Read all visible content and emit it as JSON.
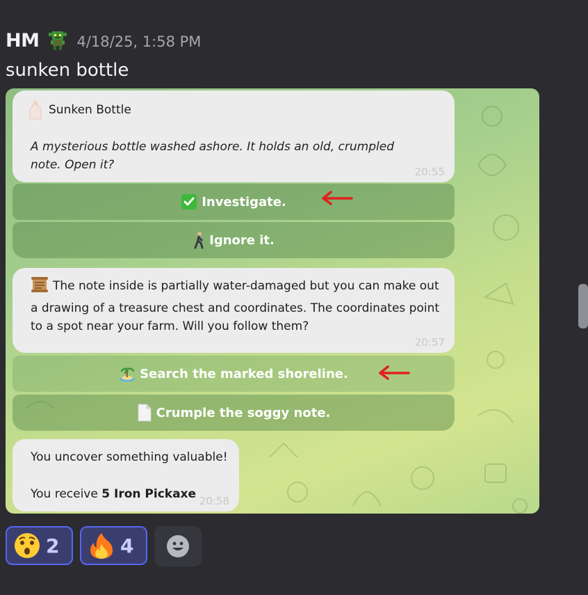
{
  "message": {
    "author": "HM",
    "timestamp": "4/18/25, 1:58 PM",
    "text": "sunken bottle"
  },
  "screenshot": {
    "card1": {
      "title": "Sunken Bottle",
      "description": "A mysterious bottle washed ashore. It holds an old, crumpled note. Open it?",
      "time": "20:55",
      "icon": "bottle-icon"
    },
    "buttons1": [
      {
        "label": "Investigate.",
        "icon": "checkmark-icon"
      },
      {
        "label": "Ignore it.",
        "icon": "walking-person-icon"
      }
    ],
    "card2": {
      "text": "The note inside is partially water-damaged but you can make out a drawing of a treasure chest and coordinates. The coordinates point to a spot near your farm. Will you follow them?",
      "time": "20:57",
      "icon": "scroll-icon"
    },
    "buttons2": [
      {
        "label": "Search the marked shoreline.",
        "icon": "island-icon"
      },
      {
        "label": "Crumple the soggy note.",
        "icon": "page-icon"
      }
    ],
    "card3": {
      "line1": "You uncover something valuable!",
      "line2_prefix": "You receive",
      "line2_bold": "5 Iron Pickaxe",
      "time": "20:58"
    },
    "annotation_color": "#e0201c",
    "chat_bg_colors": [
      "#8fbe82",
      "#d3e48f"
    ]
  },
  "reactions": [
    {
      "emoji": "astonished-face-icon",
      "count": "2"
    },
    {
      "emoji": "fire-icon",
      "count": "4"
    }
  ],
  "add_reaction": {
    "icon": "add-reaction-icon"
  },
  "colors": {
    "background": "#2b2b30",
    "reaction_border": "#5865f2",
    "reaction_bg": "#3a3e6e"
  }
}
